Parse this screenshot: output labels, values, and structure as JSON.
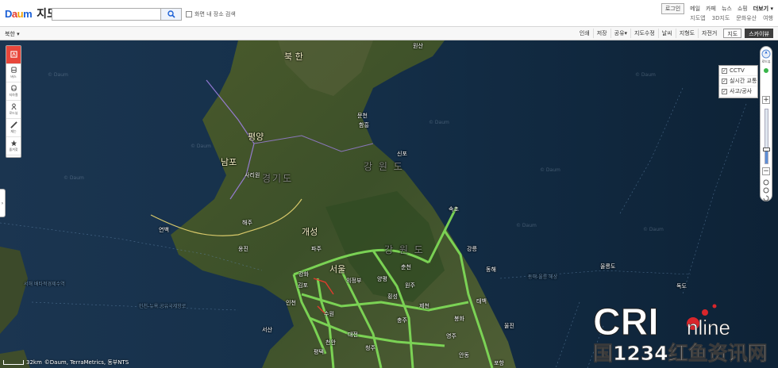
{
  "header": {
    "logo_letters": [
      "D",
      "a",
      "u",
      "m"
    ],
    "service": "지도",
    "search_placeholder": "",
    "search_icon": "magnifier-icon",
    "option_label": "화면 내 장소 검색",
    "nav": [
      "로그인",
      "메일",
      "카페",
      "뉴스",
      "쇼핑",
      "더보기"
    ],
    "subnav": [
      "지도앱",
      "3D지도",
      "문화유산",
      "여행"
    ]
  },
  "toolbar": {
    "region": "북한",
    "tools": [
      "인쇄",
      "저장",
      "공유",
      "지도수정",
      "날씨",
      "지형도",
      "자전거"
    ],
    "map_types": [
      "지도",
      "스카이뷰"
    ],
    "active_map_type": "스카이뷰"
  },
  "left_panel": {
    "items": [
      {
        "label": "",
        "icon": "route-icon"
      },
      {
        "label": "버스",
        "icon": "bus-icon"
      },
      {
        "label": "지하철",
        "icon": "subway-icon"
      },
      {
        "label": "로드뷰",
        "icon": "roadview-icon"
      },
      {
        "label": "재는",
        "icon": "ruler-icon"
      },
      {
        "label": "즐겨찾",
        "icon": "star-icon"
      }
    ]
  },
  "right_controls": {
    "compass_label": "로드뷰",
    "zoom_level_fraction": 0.25,
    "overlay": [
      {
        "label": "CCTV",
        "checked": true
      },
      {
        "label": "실시간 교통",
        "checked": true
      },
      {
        "label": "사고/공사",
        "checked": true
      }
    ]
  },
  "map": {
    "major_labels": [
      {
        "id": "north-korea",
        "text": "북 한"
      },
      {
        "id": "pyongyang",
        "text": "평양"
      },
      {
        "id": "nampo",
        "text": "남포"
      },
      {
        "id": "kaesong",
        "text": "개성"
      },
      {
        "id": "seoul",
        "text": "서울"
      },
      {
        "id": "gangwon",
        "text": "강 원 도"
      },
      {
        "id": "gyeonggi",
        "text": "경기도"
      }
    ],
    "city_labels": [
      "원산",
      "문천",
      "함흥",
      "신포",
      "사리원",
      "해주",
      "속초",
      "강릉",
      "동해",
      "춘천",
      "원주",
      "충주",
      "청주",
      "제천",
      "태백",
      "영주",
      "안동",
      "대전",
      "포항",
      "울릉도",
      "독도",
      "울진",
      "인천",
      "수원",
      "평택",
      "천안",
      "서산",
      "연백",
      "옹진",
      "강화",
      "김포",
      "파주",
      "의정부",
      "양평",
      "횡성",
      "봉화"
    ],
    "sea_labels": [
      "인천-뉴욕 공유국제항로",
      "동해-울릉 해상",
      "서해 배타적경제수역"
    ],
    "watermark": "© Daum",
    "scale_label": "32km",
    "copyright": "©Daum, TerraMetrics, 동부NTS"
  },
  "watermark_logo": {
    "text": "CRI online",
    "subtext": "国1234红鱼资讯网"
  },
  "colors": {
    "accent": "#5d8fd6",
    "traffic_good": "#7ed957",
    "highlight": "#e23b2e"
  }
}
